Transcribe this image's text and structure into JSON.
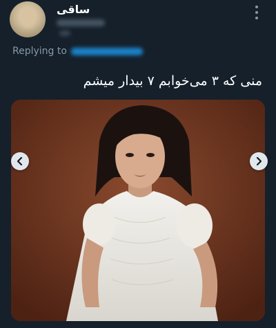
{
  "tweet": {
    "display_name": "ساقی",
    "replying_to_label": "Replying to",
    "text": "منی که ۳ می‌خوابم ۷ بیدار میشم"
  },
  "icons": {
    "more": "more-vertical-icon",
    "prev": "chevron-left-icon",
    "next": "chevron-right-icon"
  },
  "colors": {
    "background": "#15202b",
    "text_primary": "#ffffff",
    "text_secondary": "#8899a6",
    "link": "#1d9bf0",
    "photo_backdrop": "#6a2f1e"
  }
}
